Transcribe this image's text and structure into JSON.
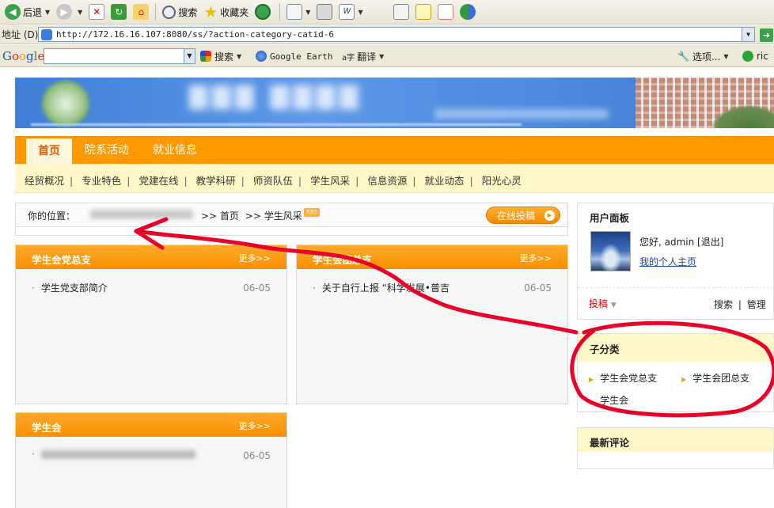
{
  "browser": {
    "back_label": "后退",
    "search_label": "搜索",
    "favorites_label": "收藏夹",
    "address_label": "地址 (D)",
    "url": "http://172.16.16.107:8080/ss/?action-category-catid-6",
    "google_search_label": "搜索",
    "google_earth_label": "Google Earth",
    "translate_label": "翻译",
    "options_label": "选项...",
    "user_truncated": "ric",
    "colors": {
      "chrome": "#ece9d8",
      "go_green": "#3aa34a"
    }
  },
  "site": {
    "nav_main": [
      "首页",
      "院系活动",
      "就业信息"
    ],
    "nav_sub": [
      "经贸概况",
      "专业特色",
      "党建在线",
      "教学科研",
      "师资队伍",
      "学生风采",
      "信息资源",
      "就业动态",
      "阳光心灵"
    ],
    "breadcrumb": {
      "prefix": "你的位置：",
      "home": ">> 首页",
      "current": ">> 学生风采",
      "rss": "RSS"
    },
    "submit_button": "在线投稿",
    "panels": [
      {
        "title": "学生会党总支",
        "more": "更多>>",
        "item": "学生党支部简介",
        "date": "06-05"
      },
      {
        "title": "学生会团总支",
        "more": "更多>>",
        "item": "关于自行上报 “科学发展•普吉",
        "date": "06-05"
      },
      {
        "title": "学生会",
        "more": "更多>>",
        "item": "",
        "date": "06-05"
      }
    ],
    "user_panel": {
      "title": "用户面板",
      "greeting": "您好, admin [退出]",
      "homepage": "我的个人主页",
      "post": "投稿",
      "search": "搜索",
      "sep": "|",
      "manage": "管理"
    },
    "subcategory": {
      "title": "子分类",
      "items": [
        "学生会党总支",
        "学生会团总支",
        "学生会"
      ]
    },
    "latest_comments": "最新评论",
    "colors": {
      "orange": "#ff9900",
      "nav_active_text": "#e35a00",
      "light_yellow": "#fff7c8",
      "annotation_red": "#e8002a"
    }
  }
}
